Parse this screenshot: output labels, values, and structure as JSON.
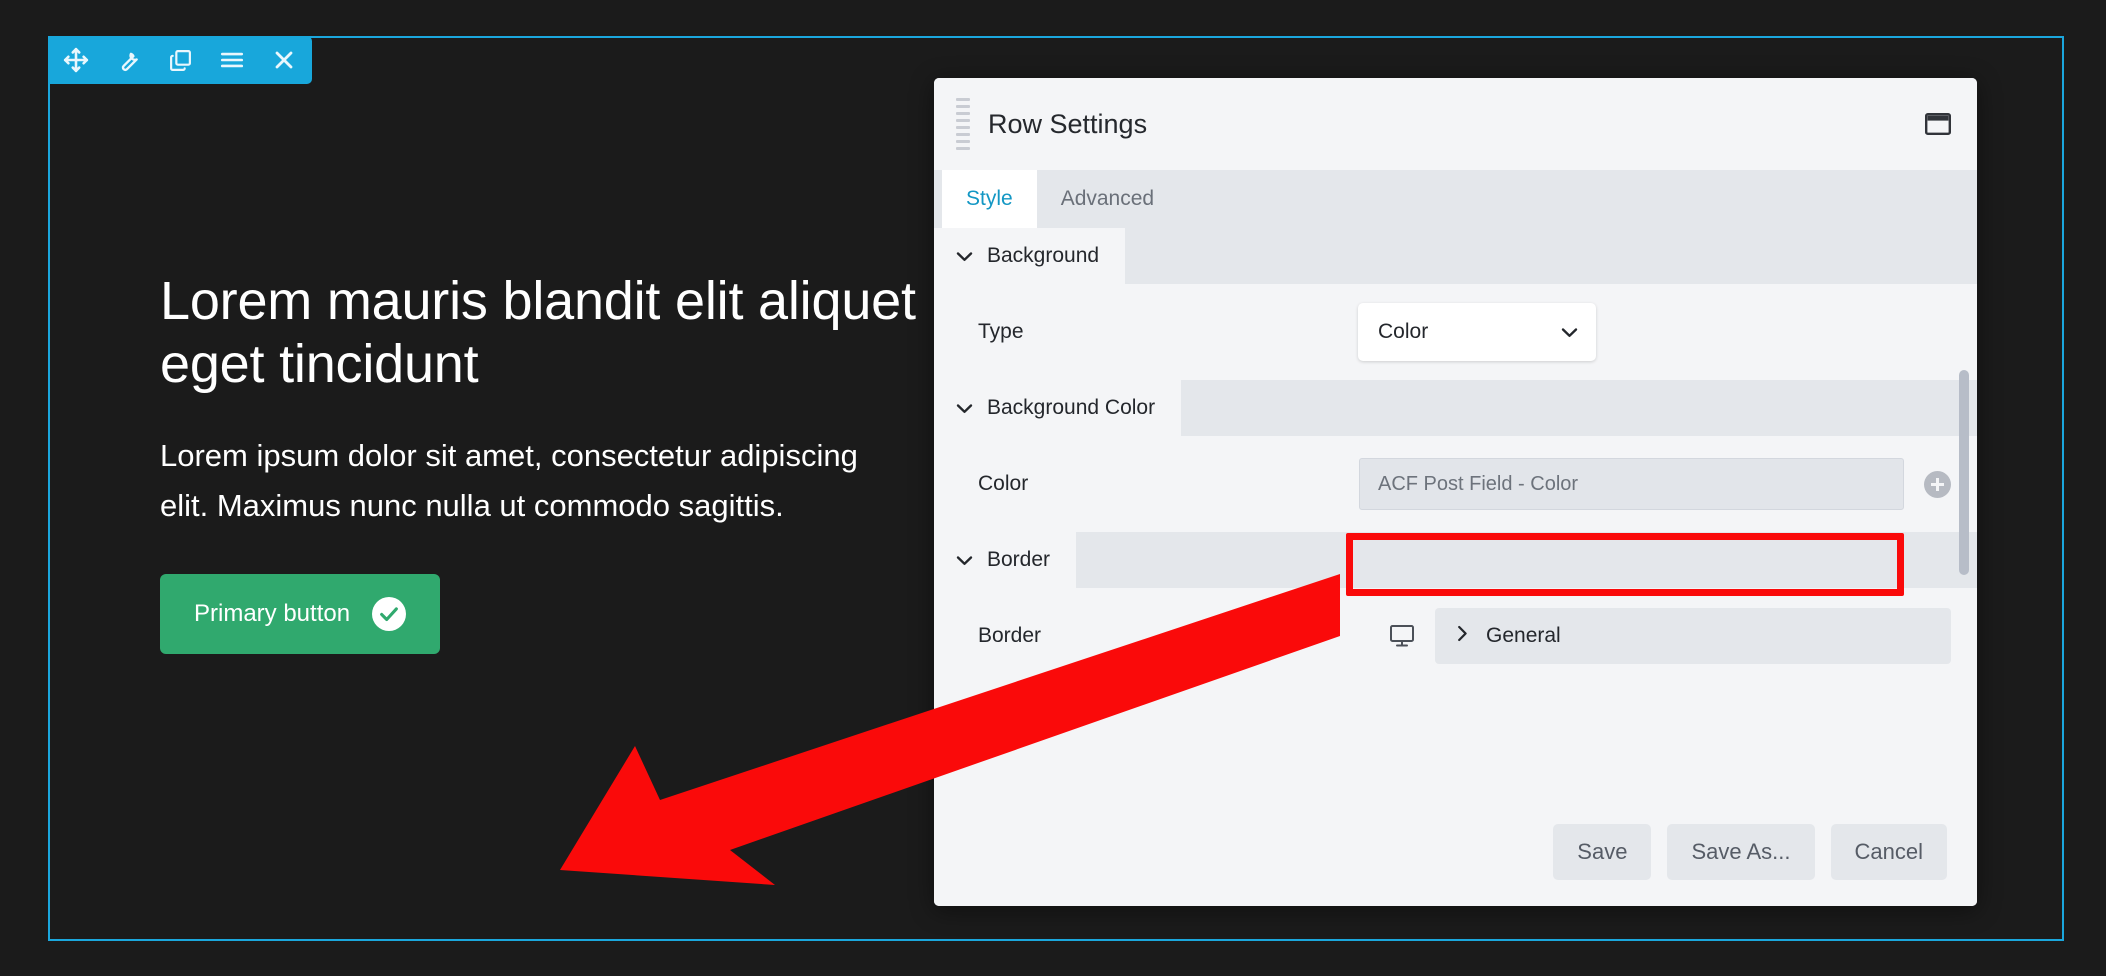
{
  "module_toolbar": {
    "buttons": [
      {
        "name": "move-icon",
        "title": "Move"
      },
      {
        "name": "wrench-icon",
        "title": "Settings"
      },
      {
        "name": "duplicate-icon",
        "title": "Duplicate"
      },
      {
        "name": "hamburger-icon",
        "title": "Menu"
      },
      {
        "name": "close-icon",
        "title": "Remove"
      }
    ],
    "accent_color": "#18a7db"
  },
  "hero": {
    "heading": "Lorem mauris blandit elit aliquet eget tincidunt",
    "body": "Lorem ipsum dolor sit amet, consectetur adipiscing elit. Maximus nunc nulla ut commodo sagittis.",
    "button_label": "Primary button",
    "button_icon": "check-circle-icon",
    "button_color": "#30a96e",
    "text_color": "#ffffff",
    "background_color": "#1b1b1b"
  },
  "panel": {
    "title": "Row Settings",
    "window_icon": "window-restore-icon",
    "drag_handle_icon": "drag-handle-icon",
    "tabs": [
      {
        "label": "Style",
        "active": true
      },
      {
        "label": "Advanced",
        "active": false
      }
    ],
    "active_tab_color": "#1397c4",
    "sections": [
      {
        "id": "background",
        "title": "Background",
        "chevron": "chevron-down-icon",
        "rows": [
          {
            "label": "Type",
            "control": "select",
            "value": "Color",
            "chevron": "chevron-down-icon"
          }
        ]
      },
      {
        "id": "background-color",
        "title": "Background Color",
        "chevron": "chevron-down-icon",
        "rows": [
          {
            "label": "Color",
            "control": "acf-field",
            "value": "ACF Post Field - Color",
            "add_icon": "plus-circle-icon"
          }
        ]
      },
      {
        "id": "border",
        "title": "Border",
        "chevron": "chevron-down-icon",
        "rows": [
          {
            "label": "Border",
            "control": "expandable",
            "device_icon": "desktop-icon",
            "value": "General",
            "chevron": "chevron-right-icon"
          }
        ]
      }
    ],
    "footer": {
      "save_label": "Save",
      "save_as_label": "Save As...",
      "cancel_label": "Cancel"
    },
    "scrollbar": "vertical-scrollbar"
  },
  "annotations": {
    "highlight_color": "#fa0a0a",
    "highlight_target": "ACF Post Field - Color",
    "arrow": "red-arrow-pointing-left-down"
  }
}
